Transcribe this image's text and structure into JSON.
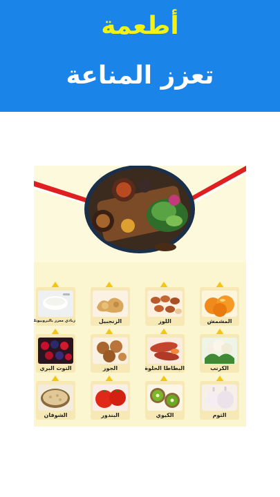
{
  "header": {
    "title_line1": "أطعمة",
    "title_line2": "تعزز المناعة",
    "background_color": "#1a84e8",
    "line1_color": "#f2f21a",
    "line2_color": "#ffffff"
  },
  "poster": {
    "background_color": "#fbf6cf",
    "accent_stripe_color": "#e02020",
    "center_image": "salad-platter",
    "foods": [
      {
        "label": "المشمش",
        "icon": "apricot"
      },
      {
        "label": "اللوز",
        "icon": "almond"
      },
      {
        "label": "الزنجبيل",
        "icon": "ginger"
      },
      {
        "label": "زبادي معزز بالبروبيوتك",
        "icon": "yogurt"
      },
      {
        "label": "الكرنب",
        "icon": "cauliflower"
      },
      {
        "label": "البطاطا الحلوة",
        "icon": "sweet-potato"
      },
      {
        "label": "الجوز",
        "icon": "walnut"
      },
      {
        "label": "التوت البري",
        "icon": "berries"
      },
      {
        "label": "الثوم",
        "icon": "garlic"
      },
      {
        "label": "الكيوي",
        "icon": "kiwi"
      },
      {
        "label": "البندور",
        "icon": "tomato"
      },
      {
        "label": "الشوفان",
        "icon": "oats"
      }
    ]
  }
}
